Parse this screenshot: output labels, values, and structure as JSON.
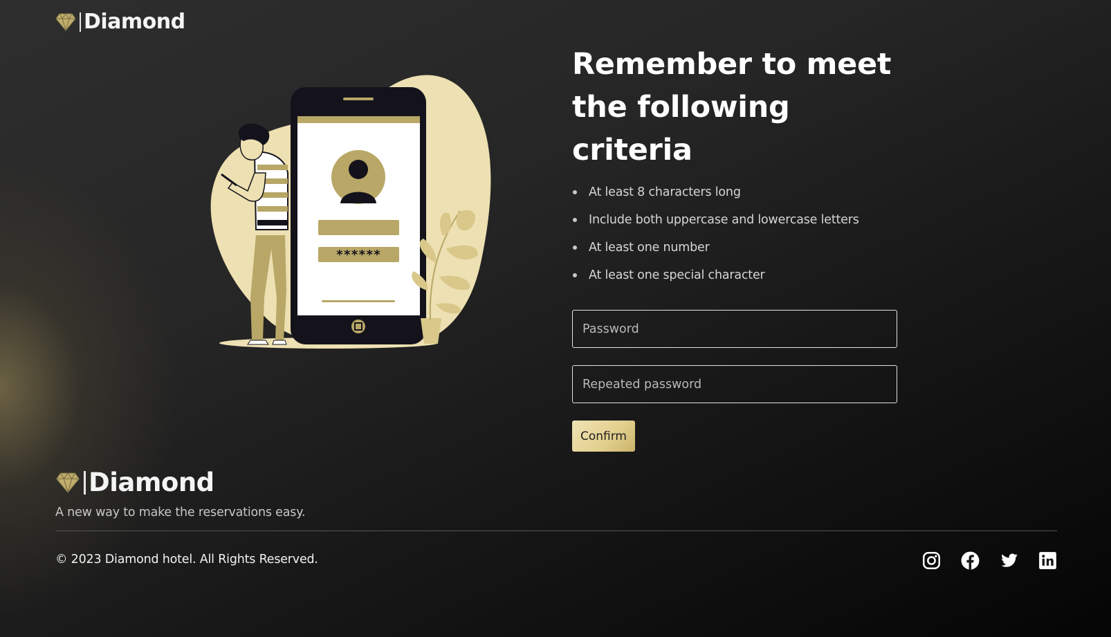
{
  "brand": {
    "name": "Diamond",
    "accent_color": "#b8a766",
    "light_accent_color": "#ede0b2"
  },
  "main": {
    "heading": "Remember to meet the following criteria",
    "criteria": [
      "At least 8 characters long",
      "Include both uppercase and lowercase letters",
      "At least one number",
      "At least one special character"
    ],
    "password": {
      "placeholder": "Password",
      "value": ""
    },
    "repeat_password": {
      "placeholder": "Repeated password",
      "value": ""
    },
    "confirm_label": "Confirm"
  },
  "illustration": {
    "masked_password": "******"
  },
  "footer": {
    "tagline": "A new way to make the reservations easy.",
    "copyright": "© 2023 Diamond hotel. All Rights Reserved.",
    "socials": [
      "instagram-icon",
      "facebook-icon",
      "twitter-icon",
      "linkedin-icon"
    ]
  }
}
